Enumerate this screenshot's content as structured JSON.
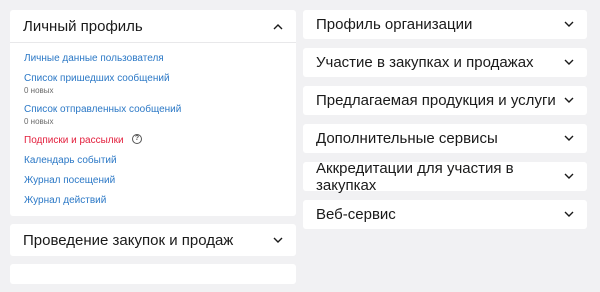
{
  "left": {
    "profile": {
      "title": "Личный профиль",
      "links": [
        {
          "label": "Личные данные пользователя",
          "sub": ""
        },
        {
          "label": "Список пришедших сообщений",
          "sub": "0 новых"
        },
        {
          "label": "Список отправленных сообщений",
          "sub": "0 новых"
        },
        {
          "label": "Подписки и рассылки",
          "sub": ""
        },
        {
          "label": "Календарь событий",
          "sub": ""
        },
        {
          "label": "Журнал посещений",
          "sub": ""
        },
        {
          "label": "Журнал действий",
          "sub": ""
        }
      ],
      "help_glyph": "?"
    },
    "procurement": {
      "title": "Проведение закупок и продаж"
    }
  },
  "right": {
    "sections": [
      {
        "title": "Профиль организации"
      },
      {
        "title": "Участие в закупках и продажах"
      },
      {
        "title": "Предлагаемая продукция и услуги"
      },
      {
        "title": "Дополнительные сервисы"
      },
      {
        "title": "Аккредитации для участия в закупках"
      },
      {
        "title": "Веб-сервис"
      }
    ]
  },
  "colors": {
    "link": "#2b78c6",
    "link_highlight": "#e31e3c",
    "background": "#f1f1f3",
    "card": "#ffffff"
  }
}
